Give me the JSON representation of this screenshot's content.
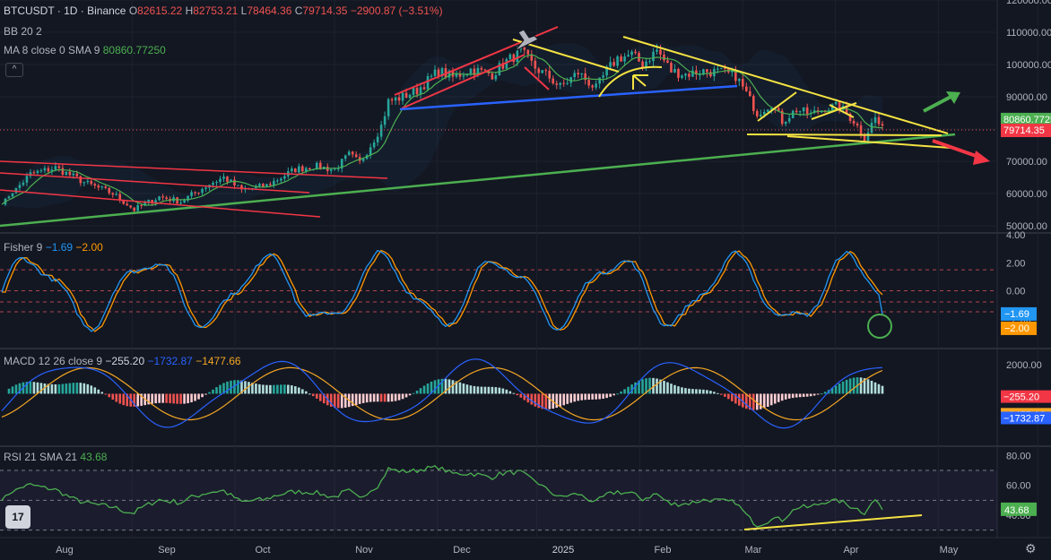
{
  "header": {
    "symbol": "BTCUSDT · 1D · Binance",
    "o_label": "O",
    "o_val": "82615.22",
    "h_label": "H",
    "h_val": "82753.21",
    "l_label": "L",
    "l_val": "78464.36",
    "c_label": "C",
    "c_val": "79714.35",
    "change": "−2900.87 (−3.51%)",
    "bb": "BB 20 2",
    "ma_label": "MA 8 close 0 SMA 9",
    "ma_val": "80860.77250"
  },
  "panels": {
    "fisher": {
      "label": "Fisher 9",
      "v1": "−1.69",
      "v2": "−2.00"
    },
    "macd": {
      "label": "MACD 12 26 close 9",
      "v1": "−255.20",
      "v2": "−1732.87",
      "v3": "−1477.66"
    },
    "rsi": {
      "label": "RSI 21 SMA 21",
      "v1": "43.68"
    }
  },
  "colors": {
    "up": "#26a69a",
    "down": "#ef5350",
    "yellow": "#f5e342",
    "blue": "#2962ff",
    "green": "#4caf50",
    "red": "#f23645",
    "orange": "#ff9800",
    "fisherBlue": "#2196f3"
  },
  "chart_data": {
    "type": "candlestick",
    "symbol": "BTCUSDT",
    "interval": "1D",
    "exchange": "Binance",
    "x_ticks": [
      "Aug",
      "Sep",
      "Oct",
      "Nov",
      "Dec",
      "2025",
      "Feb",
      "Mar",
      "Apr",
      "May"
    ],
    "price_axis": {
      "ylim": [
        45000,
        120000
      ],
      "ticks": [
        "120000.00",
        "110000.00",
        "100000.00",
        "90000.00",
        "80000.00",
        "70000.00",
        "60000.00",
        "50000.00"
      ]
    },
    "price_labels": {
      "ma": "80860.7725",
      "last": "79714.35"
    },
    "price_keypoints": [
      {
        "d": 0,
        "v": 57000
      },
      {
        "d": 8,
        "v": 66000
      },
      {
        "d": 15,
        "v": 68000
      },
      {
        "d": 24,
        "v": 63000
      },
      {
        "d": 31,
        "v": 60000
      },
      {
        "d": 37,
        "v": 55000
      },
      {
        "d": 44,
        "v": 59000
      },
      {
        "d": 50,
        "v": 57500
      },
      {
        "d": 58,
        "v": 63000
      },
      {
        "d": 62,
        "v": 65000
      },
      {
        "d": 67,
        "v": 61000
      },
      {
        "d": 74,
        "v": 62500
      },
      {
        "d": 82,
        "v": 67500
      },
      {
        "d": 87,
        "v": 68500
      },
      {
        "d": 93,
        "v": 67500
      },
      {
        "d": 97,
        "v": 72000
      },
      {
        "d": 100,
        "v": 69500
      },
      {
        "d": 103,
        "v": 75000
      },
      {
        "d": 106,
        "v": 81000
      },
      {
        "d": 108,
        "v": 88500
      },
      {
        "d": 112,
        "v": 90000
      },
      {
        "d": 116,
        "v": 92000
      },
      {
        "d": 122,
        "v": 98000
      },
      {
        "d": 126,
        "v": 96000
      },
      {
        "d": 131,
        "v": 98500
      },
      {
        "d": 137,
        "v": 97000
      },
      {
        "d": 141,
        "v": 101000
      },
      {
        "d": 145,
        "v": 104000
      },
      {
        "d": 149,
        "v": 99000
      },
      {
        "d": 153,
        "v": 96000
      },
      {
        "d": 156,
        "v": 93000
      },
      {
        "d": 161,
        "v": 97500
      },
      {
        "d": 166,
        "v": 92500
      },
      {
        "d": 169,
        "v": 98000
      },
      {
        "d": 172,
        "v": 102000
      },
      {
        "d": 176,
        "v": 103000
      },
      {
        "d": 179,
        "v": 100000
      },
      {
        "d": 183,
        "v": 104500
      },
      {
        "d": 187,
        "v": 98000
      },
      {
        "d": 191,
        "v": 97000
      },
      {
        "d": 196,
        "v": 98000
      },
      {
        "d": 201,
        "v": 97500
      },
      {
        "d": 205,
        "v": 96500
      },
      {
        "d": 208,
        "v": 91000
      },
      {
        "d": 211,
        "v": 85000
      },
      {
        "d": 215,
        "v": 88000
      },
      {
        "d": 218,
        "v": 82500
      },
      {
        "d": 222,
        "v": 86000
      },
      {
        "d": 226,
        "v": 84500
      },
      {
        "d": 230,
        "v": 86500
      },
      {
        "d": 234,
        "v": 87000
      },
      {
        "d": 238,
        "v": 82500
      },
      {
        "d": 241,
        "v": 77500
      },
      {
        "d": 244,
        "v": 83500
      },
      {
        "d": 246,
        "v": 79700
      }
    ],
    "ma_line_end": 80860.77,
    "fisher": {
      "ylim": [
        -4.0,
        4.0
      ],
      "ticks": [
        "4.00",
        "2.00",
        "0.00",
        "−2.00"
      ],
      "last": [
        -1.69,
        -2.0
      ]
    },
    "macd": {
      "ylim": [
        -3500,
        3000
      ],
      "ticks": [
        "2000.00",
        "0.00"
      ],
      "last": [
        -255.2,
        -1732.87,
        -1477.66
      ]
    },
    "rsi": {
      "ylim": [
        25,
        85
      ],
      "ticks": [
        "80.00",
        "60.00",
        "40.00"
      ],
      "levels": [
        70,
        50,
        30
      ],
      "last": 43.68
    }
  }
}
